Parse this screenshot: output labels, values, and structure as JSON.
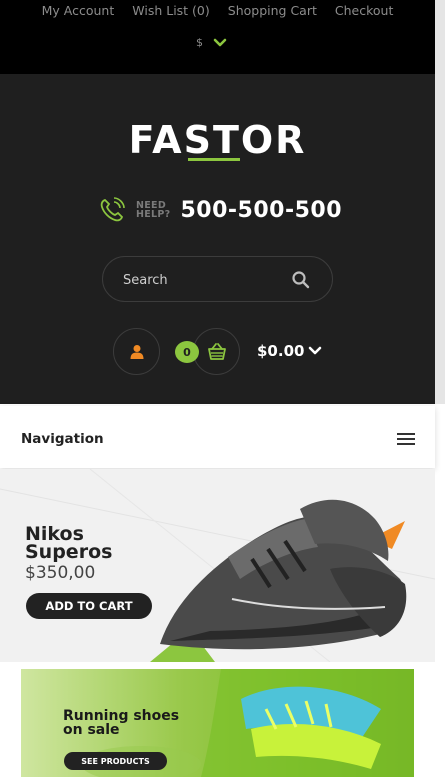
{
  "top_links": [
    "My Account",
    "Wish List (0)",
    "Shopping Cart",
    "Checkout"
  ],
  "currency": {
    "symbol": "$",
    "chevron_icon": "chevron-down-icon"
  },
  "logo": {
    "text": "FASTOR"
  },
  "help": {
    "need": "NEED",
    "help": "HELP?",
    "phone": "500-500-500"
  },
  "search": {
    "placeholder": "Search",
    "icon": "search-icon"
  },
  "cart": {
    "count": "0",
    "total": "$0.00",
    "icon": "basket-icon"
  },
  "user": {
    "icon": "user-icon"
  },
  "nav": {
    "title": "Navigation",
    "menu_icon": "hamburger-icon"
  },
  "banner1": {
    "title_line1": "Nikos",
    "title_line2": "Superos",
    "price": "$350,00",
    "button": "ADD TO CART"
  },
  "banner2": {
    "title_line1": "Running shoes",
    "title_line2": "on sale",
    "button": "SEE PRODUCTS"
  },
  "colors": {
    "accent": "#8cc63f",
    "dark": "#1f1f1f",
    "black": "#000000"
  }
}
